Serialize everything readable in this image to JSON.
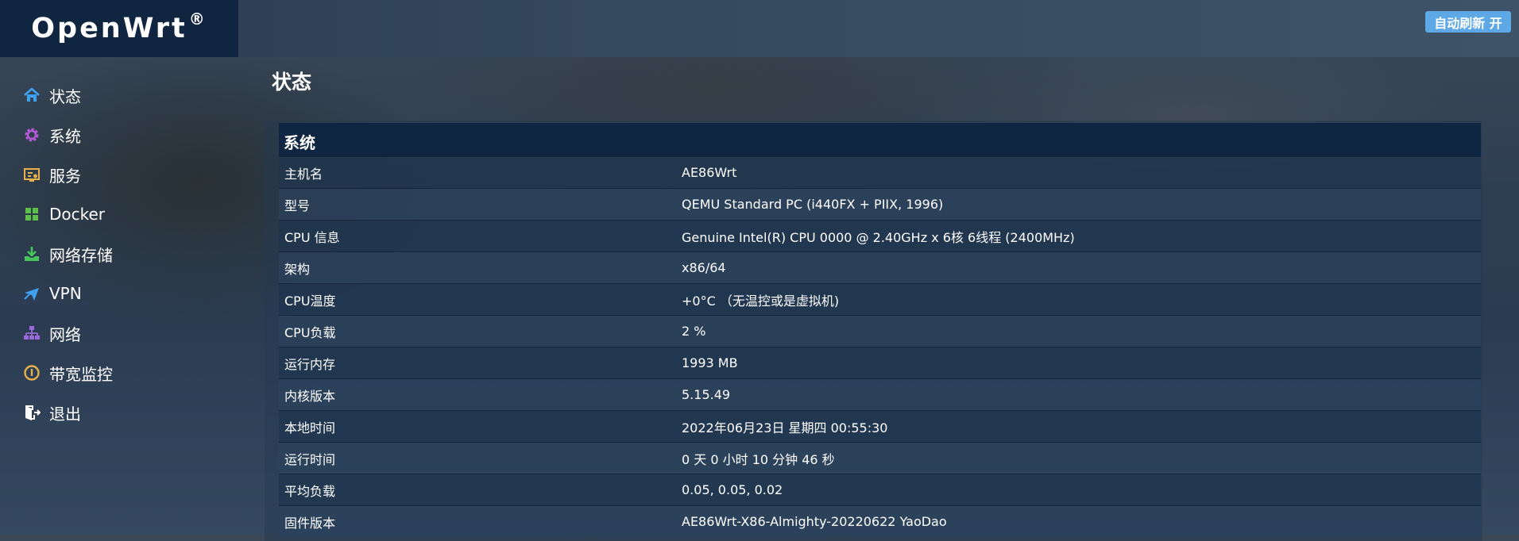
{
  "brand": {
    "name": "OpenWrt",
    "mark": "®"
  },
  "header": {
    "refresh_label": "自动刷新 开"
  },
  "sidebar": {
    "items": [
      {
        "label": "状态",
        "icon": "home-icon"
      },
      {
        "label": "系统",
        "icon": "gear-icon"
      },
      {
        "label": "服务",
        "icon": "services-icon"
      },
      {
        "label": "Docker",
        "icon": "grid-icon"
      },
      {
        "label": "网络存储",
        "icon": "download-icon"
      },
      {
        "label": "VPN",
        "icon": "plane-icon"
      },
      {
        "label": "网络",
        "icon": "network-icon"
      },
      {
        "label": "带宽监控",
        "icon": "gauge-icon"
      },
      {
        "label": "退出",
        "icon": "logout-icon"
      }
    ]
  },
  "main": {
    "title": "状态",
    "section_title": "系统",
    "rows": [
      {
        "key": "主机名",
        "value": "AE86Wrt"
      },
      {
        "key": "型号",
        "value": "QEMU Standard PC (i440FX + PIIX, 1996)"
      },
      {
        "key": "CPU 信息",
        "value": "Genuine Intel(R) CPU 0000 @ 2.40GHz x 6核 6线程 (2400MHz)"
      },
      {
        "key": "架构",
        "value": "x86/64"
      },
      {
        "key": "CPU温度",
        "value": "+0°C （无温控或是虚拟机)"
      },
      {
        "key": "CPU负载",
        "value": "2 %"
      },
      {
        "key": "运行内存",
        "value": "1993 MB"
      },
      {
        "key": "内核版本",
        "value": "5.15.49"
      },
      {
        "key": "本地时间",
        "value": "2022年06月23日 星期四 00:55:30"
      },
      {
        "key": "运行时间",
        "value": "0 天 0 小时 10 分钟 46 秒"
      },
      {
        "key": "平均负载",
        "value": "0.05, 0.05, 0.02"
      },
      {
        "key": "固件版本",
        "value": "AE86Wrt-X86-Almighty-20220622 YaoDao"
      }
    ]
  },
  "colors": {
    "brand_bg": "#0f2540",
    "refresh_button": "#5fa8e6",
    "section_header": "#0e2642",
    "icon_home": "#3fa0f0",
    "icon_gear": "#b45ad8",
    "icon_services": "#e8b04a",
    "icon_docker": "#5cbf4a",
    "icon_download": "#47c45a",
    "icon_vpn": "#3fa0f0",
    "icon_network": "#9a6ad8",
    "icon_gauge": "#e8b04a",
    "icon_logout": "#ffffff"
  }
}
